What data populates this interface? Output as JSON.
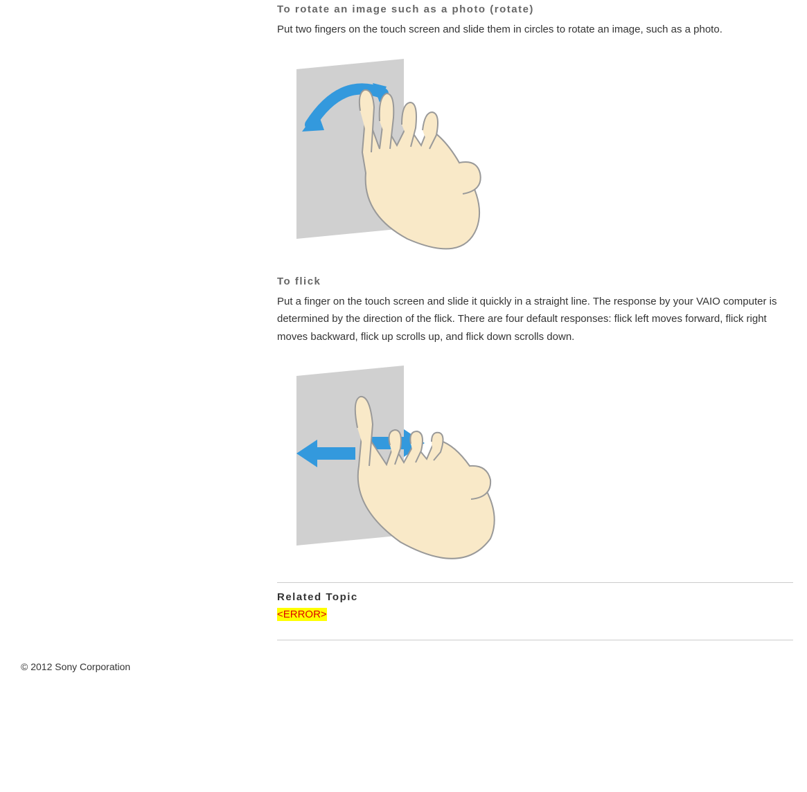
{
  "sections": {
    "rotate": {
      "heading": "To rotate an image such as a photo (rotate)",
      "body": "Put two fingers on the touch screen and slide them in circles to rotate an image, such as a photo."
    },
    "flick": {
      "heading": "To flick",
      "body": "Put a finger on the touch screen and slide it quickly in a straight line. The response by your VAIO computer is determined by the direction of the flick. There are four default responses: flick left moves forward, flick right moves backward, flick up scrolls up, and flick down scrolls down."
    }
  },
  "related": {
    "heading": "Related Topic",
    "error_text": "<ERROR>"
  },
  "footer": {
    "copyright": "© 2012 Sony Corporation"
  }
}
